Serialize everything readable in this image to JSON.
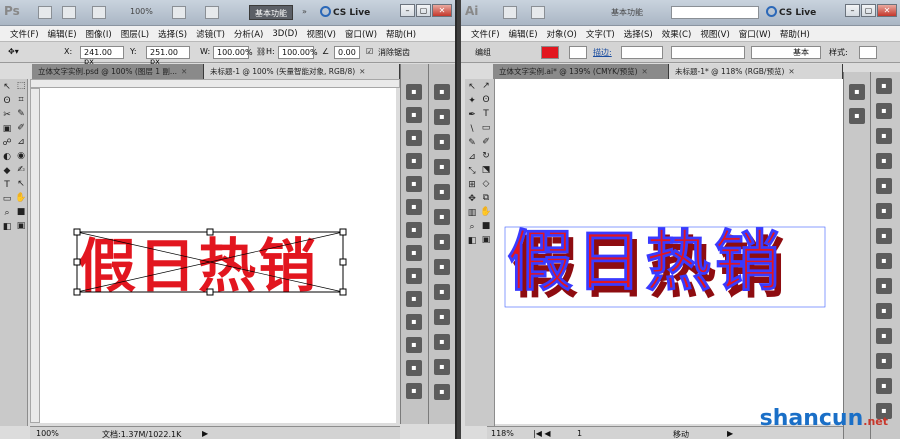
{
  "ps": {
    "logo": "Ps",
    "zoom": "100%",
    "workspace": "基本功能",
    "cslive": "CS Live",
    "menu": [
      "文件(F)",
      "编辑(E)",
      "图像(I)",
      "图层(L)",
      "选择(S)",
      "滤镜(T)",
      "分析(A)",
      "3D(D)",
      "视图(V)",
      "窗口(W)",
      "帮助(H)"
    ],
    "options": {
      "x_label": "X:",
      "x": "241.00 px",
      "y_label": "Y:",
      "y": "251.00 px",
      "w_label": "W:",
      "w": "100.00%",
      "h_label": "H:",
      "h": "100.00%",
      "angle": "0.00",
      "aa": "消除锯齿"
    },
    "tabs": [
      {
        "label": "立体文字实例.psd @ 100% (图层 1 副..."
      },
      {
        "label": "未标题-1 @ 100% (矢量智能对象, RGB/8)"
      }
    ],
    "canvas_text": "假日热销",
    "status": {
      "zoom": "100%",
      "doc": "文档:1.37M/1022.1K"
    }
  },
  "ai": {
    "logo": "Ai",
    "workspace": "基本功能",
    "cslive": "CS Live",
    "menu": [
      "文件(F)",
      "编辑(E)",
      "对象(O)",
      "文字(T)",
      "选择(S)",
      "效果(C)",
      "视图(V)",
      "窗口(W)",
      "帮助(H)"
    ],
    "options": {
      "group": "编组",
      "stroke": "描边:",
      "basic": "基本",
      "style": "样式:"
    },
    "tabs": [
      {
        "label": "立体文字实例.ai* @ 139% (CMYK/预览)"
      },
      {
        "label": "未标题-1* @ 118% (RGB/预览)"
      }
    ],
    "canvas_text": "假日热销",
    "status": {
      "zoom": "118%",
      "page": "1",
      "mode": "移动"
    }
  },
  "watermark": {
    "text": "shancun",
    "suffix": ".net"
  },
  "colors": {
    "red": "#e2161f",
    "dark_red": "#8e0c10"
  }
}
